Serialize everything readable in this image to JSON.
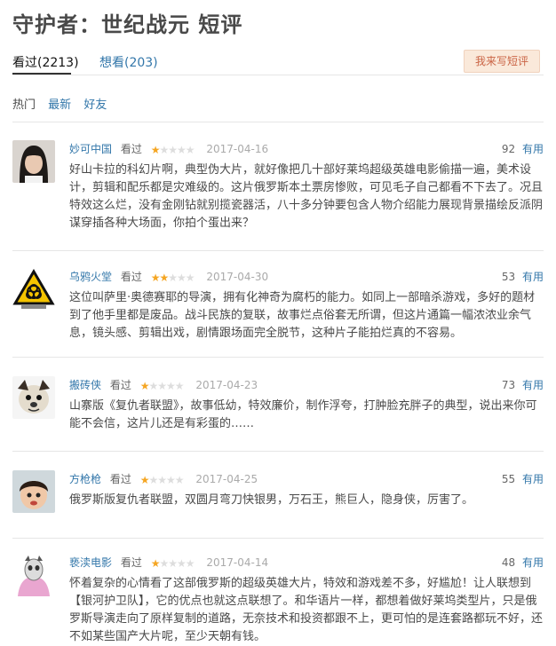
{
  "page": {
    "title": "守护者：世纪战元 短评",
    "tabs": [
      {
        "label": "看过(2213)",
        "active": true
      },
      {
        "label": "想看(203)",
        "active": false
      }
    ],
    "write_button": "我来写短评",
    "filters": [
      {
        "label": "热门",
        "active": true
      },
      {
        "label": "最新",
        "active": false
      },
      {
        "label": "好友",
        "active": false
      }
    ]
  },
  "colors": {
    "link": "#3377aa",
    "star": "#f5a623",
    "button_bg": "#fae9da",
    "button_text": "#ca6445"
  },
  "reviews": [
    {
      "user": "妙可中国",
      "status": "看过",
      "rating": 1,
      "date": "2017-04-16",
      "useful_count": "92",
      "useful_label": "有用",
      "avatar": "portrait-photo",
      "text": "好山卡拉的科幻片啊，典型伪大片，就好像把几十部好莱坞超级英雄电影偷描一遍，美术设计，剪辑和配乐都是灾难级的。这片俄罗斯本土票房惨败，可见毛子自己都看不下去了。况且特效这么烂，没有金刚钻就别揽瓷器活，八十多分钟要包含人物介绍能力展现背景描绘反派阴谋穿插各种大场面，你拍个蛋出来？"
    },
    {
      "user": "乌鸦火堂",
      "status": "看过",
      "rating": 2,
      "date": "2017-04-30",
      "useful_count": "53",
      "useful_label": "有用",
      "avatar": "hazard-logo",
      "text": "这位叫萨里·奥德赛耶的导演，拥有化神奇为腐朽的能力。如同上一部暗杀游戏，多好的题材到了他手里都是废品。战斗民族的复联，故事烂点俗套无所谓，但这片通篇一幅浓浓业余气息，镜头感、剪辑出戏，剧情跟场面完全脱节，这种片子能拍烂真的不容易。"
    },
    {
      "user": "搬砖侠",
      "status": "看过",
      "rating": 1,
      "date": "2017-04-23",
      "useful_count": "73",
      "useful_label": "有用",
      "avatar": "dog-cartoon",
      "text": "山寨版《复仇者联盟》，故事低幼，特效廉价，制作浮夸，打肿脸充胖子的典型，说出来你可能不会信，这片儿还是有彩蛋的……"
    },
    {
      "user": "方枪枪",
      "status": "看过",
      "rating": 1,
      "date": "2017-04-25",
      "useful_count": "55",
      "useful_label": "有用",
      "avatar": "child-photo",
      "text": "俄罗斯版复仇者联盟，双圆月弯刀快银男，万石王，熊巨人，隐身侠，厉害了。"
    },
    {
      "user": "亵渎电影",
      "status": "看过",
      "rating": 1,
      "date": "2017-04-14",
      "useful_count": "48",
      "useful_label": "有用",
      "avatar": "masked-figure",
      "text": "怀着复杂的心情看了这部俄罗斯的超级英雄大片，特效和游戏差不多，好尴尬！让人联想到【银河护卫队】，它的优点也就这点联想了。和华语片一样，都想着做好莱坞类型片，只是俄罗斯导演走向了原样复制的道路，无奈技术和投资都跟不上，更可怕的是连套路都玩不好，还不如某些国产大片呢，至少天朝有钱。"
    }
  ]
}
